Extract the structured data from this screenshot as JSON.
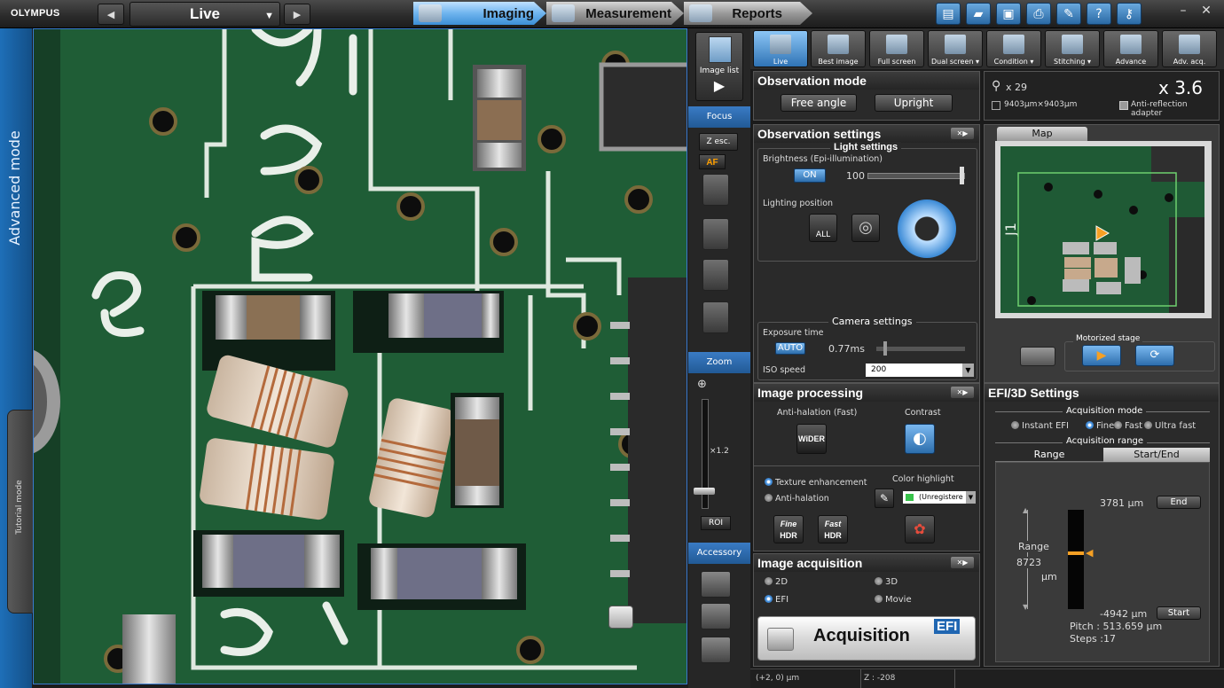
{
  "topbar": {
    "brand": "OLYMPUS",
    "mode_select": "Live",
    "tabs": [
      "Imaging",
      "Measurement",
      "Reports"
    ]
  },
  "left": {
    "advanced_mode": "Advanced mode",
    "tutorial_mode": "Tutorial mode"
  },
  "mid": {
    "image_list": "Image list",
    "focus": "Focus",
    "z_esc": "Z esc.",
    "af": "AF",
    "zoom": "Zoom",
    "zoom_value": "×1.2",
    "roi": "ROI",
    "accessory": "Accessory"
  },
  "rtoolbar": {
    "buttons": [
      "Live",
      "Best image",
      "Full screen",
      "Dual screen ▾",
      "Condition ▾",
      "Stitching ▾",
      "Advance",
      "Adv. acq."
    ]
  },
  "observation_mode": {
    "title": "Observation mode",
    "free_angle": "Free angle",
    "upright": "Upright"
  },
  "info": {
    "magnifier": "x 29",
    "fov": "9403µm×9403µm",
    "zoom": "x 3.6",
    "anti_reflection": "Anti-reflection adapter"
  },
  "map": {
    "tab": "Map",
    "motorized_stage": "Motorized stage"
  },
  "observation_settings": {
    "title": "Observation settings",
    "light_settings": "Light settings",
    "brightness_label": "Brightness (Epi-illumination)",
    "on": "ON",
    "brightness_value": "100",
    "lighting_position": "Lighting position",
    "all": "ALL",
    "camera_settings": "Camera settings",
    "exposure_time": "Exposure time",
    "auto": "AUTO",
    "exposure_value": "0.77ms",
    "iso_speed": "ISO speed",
    "iso_value": "200"
  },
  "image_processing": {
    "title": "Image processing",
    "anti_halation_fast": "Anti-halation (Fast)",
    "wider": "WiDER",
    "contrast": "Contrast",
    "texture_enhancement": "Texture enhancement",
    "anti_halation": "Anti-halation",
    "color_highlight": "Color highlight",
    "unregistered": "(Unregistere",
    "fine": "Fine",
    "fast": "Fast",
    "hdr": "HDR"
  },
  "image_acquisition": {
    "title": "Image acquisition",
    "opt_2d": "2D",
    "opt_3d": "3D",
    "opt_efi": "EFI",
    "opt_movie": "Movie",
    "acquisition": "Acquisition",
    "efi_badge": "EFI"
  },
  "efi": {
    "title": "EFI/3D Settings",
    "acq_mode": "Acquisition mode",
    "modes": [
      "Instant EFI",
      "Fine",
      "Fast",
      "Ultra fast"
    ],
    "acq_range": "Acquisition range",
    "tabs": [
      "Range",
      "Start/End"
    ],
    "end_value": "3781  µm",
    "end": "End",
    "range_label": "Range",
    "range_value": "8723",
    "range_unit": "µm",
    "start_value": "-4942  µm",
    "start": "Start",
    "pitch": "Pitch : 513.659  µm",
    "steps": "Steps :17"
  },
  "status": {
    "pos": "(+2, 0) µm",
    "z": "Z :  -208"
  }
}
